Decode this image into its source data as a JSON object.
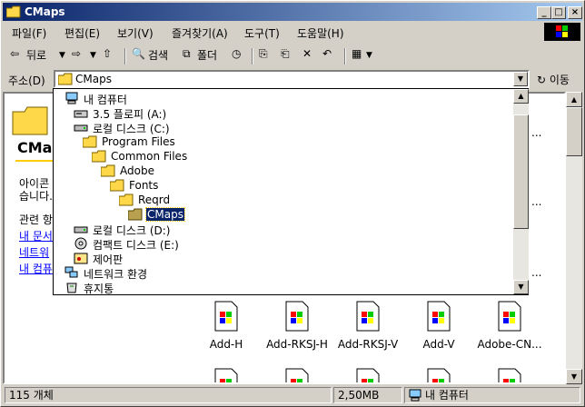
{
  "window": {
    "title": "CMaps"
  },
  "menu": [
    "파일(F)",
    "편집(E)",
    "보기(V)",
    "즐겨찾기(A)",
    "도구(T)",
    "도움말(H)"
  ],
  "toolbar": {
    "back": "뒤로",
    "search": "검색",
    "folders": "폴더"
  },
  "address": {
    "label": "주소(D)",
    "value": "CMaps",
    "go": "이동"
  },
  "left_pane": {
    "title": "CMaps",
    "desc1": "아이콘",
    "desc2": "습니다.",
    "related": "관련 항",
    "links": [
      "내 문서",
      "네트워",
      "내 컴퓨"
    ]
  },
  "dropdown_items": [
    {
      "label": "내 컴퓨터",
      "icon": "computer-icon"
    },
    {
      "label": "3.5 플로피 (A:)",
      "icon": "floppy-icon"
    },
    {
      "label": "로컬 디스크 (C:)",
      "icon": "drive-icon"
    },
    {
      "label": "Program Files",
      "icon": "folder-icon"
    },
    {
      "label": "Common Files",
      "icon": "folder-icon"
    },
    {
      "label": "Adobe",
      "icon": "folder-icon"
    },
    {
      "label": "Fonts",
      "icon": "folder-icon"
    },
    {
      "label": "Reqrd",
      "icon": "folder-icon"
    },
    {
      "label": "CMaps",
      "icon": "open-folder-icon"
    },
    {
      "label": "로컬 디스크 (D:)",
      "icon": "drive-icon"
    },
    {
      "label": "컴팩트 디스크 (E:)",
      "icon": "cdrom-icon"
    },
    {
      "label": "제어판",
      "icon": "control-panel-icon"
    },
    {
      "label": "네트워크 환경",
      "icon": "network-icon"
    },
    {
      "label": "휴지통",
      "icon": "recycle-bin-icon"
    }
  ],
  "files": [
    "Add-H",
    "Add-RKSJ-H",
    "Add-RKSJ-V",
    "Add-V",
    "Adobe-CN..."
  ],
  "status": {
    "count": "115 개체",
    "size": "2,50MB",
    "location": "내 컴퓨터"
  },
  "colors": {
    "titlebar": "#0a246a",
    "selection": "#0a246a",
    "link": "#0000ff"
  }
}
